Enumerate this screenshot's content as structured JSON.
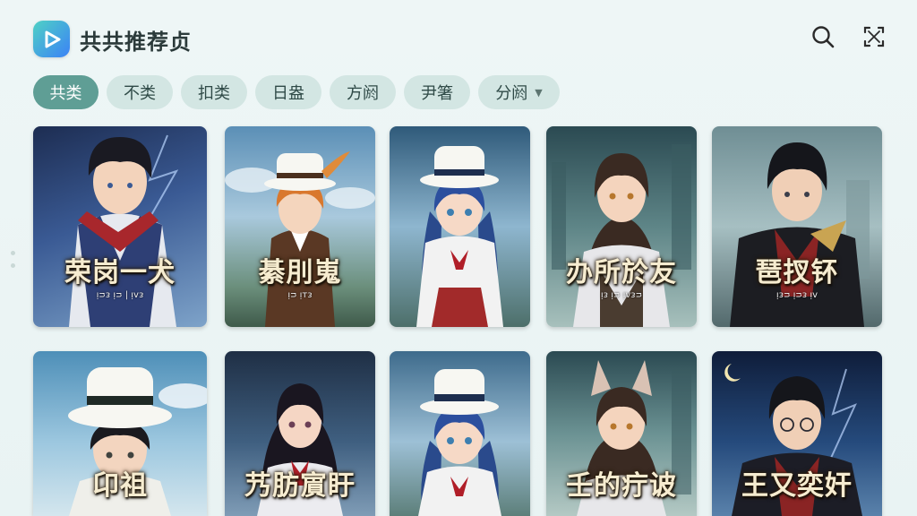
{
  "header": {
    "title": "共共推荐贞",
    "logo_icon": "play-logo-icon",
    "search_icon": "search-icon",
    "scan_icon": "scan-icon"
  },
  "chips": [
    {
      "label": "共类",
      "active": true
    },
    {
      "label": "不类",
      "active": false
    },
    {
      "label": "扣类",
      "active": false
    },
    {
      "label": "日盎",
      "active": false
    },
    {
      "label": "方阏",
      "active": false
    },
    {
      "label": "尹箸",
      "active": false
    },
    {
      "label": "分阏",
      "active": false,
      "dropdown": true
    }
  ],
  "cards": [
    {
      "title": "荣岗一犬",
      "subtitle": "ᴉᴝᴈ ᴉᴝ | ᴉᴠᴈ"
    },
    {
      "title": "綦刖嵬",
      "subtitle": "ᴉᴝ ᴉᴛᴈ"
    },
    {
      "title": "",
      "subtitle": ""
    },
    {
      "title": "办所於友",
      "subtitle": "ᴉᴈ ᴉᴝ ᴉᴠᴈᴝ"
    },
    {
      "title": "琶扠钚",
      "subtitle": "ᴉᴈᴝ ᴉᴝᴈ ᴉᴠ"
    },
    {
      "title": "卬祖",
      "subtitle": ""
    },
    {
      "title": "艿肪賔盱",
      "subtitle": ""
    },
    {
      "title": "",
      "subtitle": ""
    },
    {
      "title": "壬的疔诐",
      "subtitle": ""
    },
    {
      "title": "王又奕奸",
      "subtitle": ""
    }
  ],
  "colors": {
    "accent": "#5f9e95",
    "chip_bg": "#d3e6e3",
    "page_bg": "#eef6f6"
  }
}
